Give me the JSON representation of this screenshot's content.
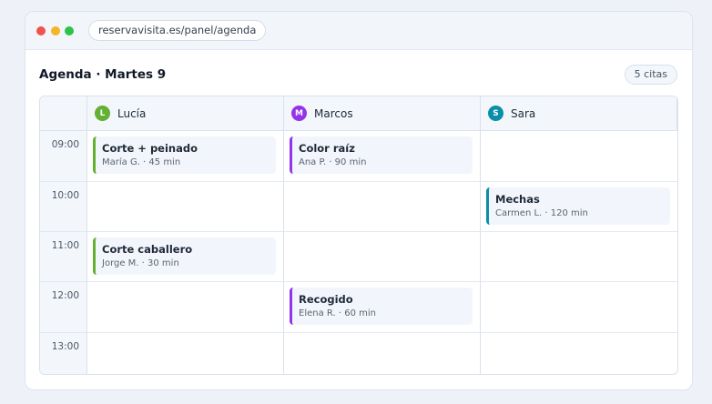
{
  "browser": {
    "url": "reservavisita.es/panel/agenda"
  },
  "header": {
    "title": "Agenda · Martes 9",
    "count_badge": "5 citas"
  },
  "staff": [
    {
      "initial": "L",
      "name": "Lucía",
      "color": "#63b033"
    },
    {
      "initial": "M",
      "name": "Marcos",
      "color": "#9333ea"
    },
    {
      "initial": "S",
      "name": "Sara",
      "color": "#0b8fa8"
    }
  ],
  "times": [
    "09:00",
    "10:00",
    "11:00",
    "12:00",
    "13:00"
  ],
  "events": [
    {
      "title": "Corte + peinado",
      "detail": "María G. · 45 min",
      "staff": "Lucía",
      "time": "09:00",
      "color": "#63b033"
    },
    {
      "title": "Color raíz",
      "detail": "Ana P. · 90 min",
      "staff": "Marcos",
      "time": "09:00",
      "color": "#9333ea"
    },
    {
      "title": "Mechas",
      "detail": "Carmen L. · 120 min",
      "staff": "Sara",
      "time": "10:00",
      "color": "#0b8fa8"
    },
    {
      "title": "Corte caballero",
      "detail": "Jorge M. · 30 min",
      "staff": "Lucía",
      "time": "11:00",
      "color": "#63b033"
    },
    {
      "title": "Recogido",
      "detail": "Elena R. · 60 min",
      "staff": "Marcos",
      "time": "12:00",
      "color": "#9333ea"
    }
  ]
}
